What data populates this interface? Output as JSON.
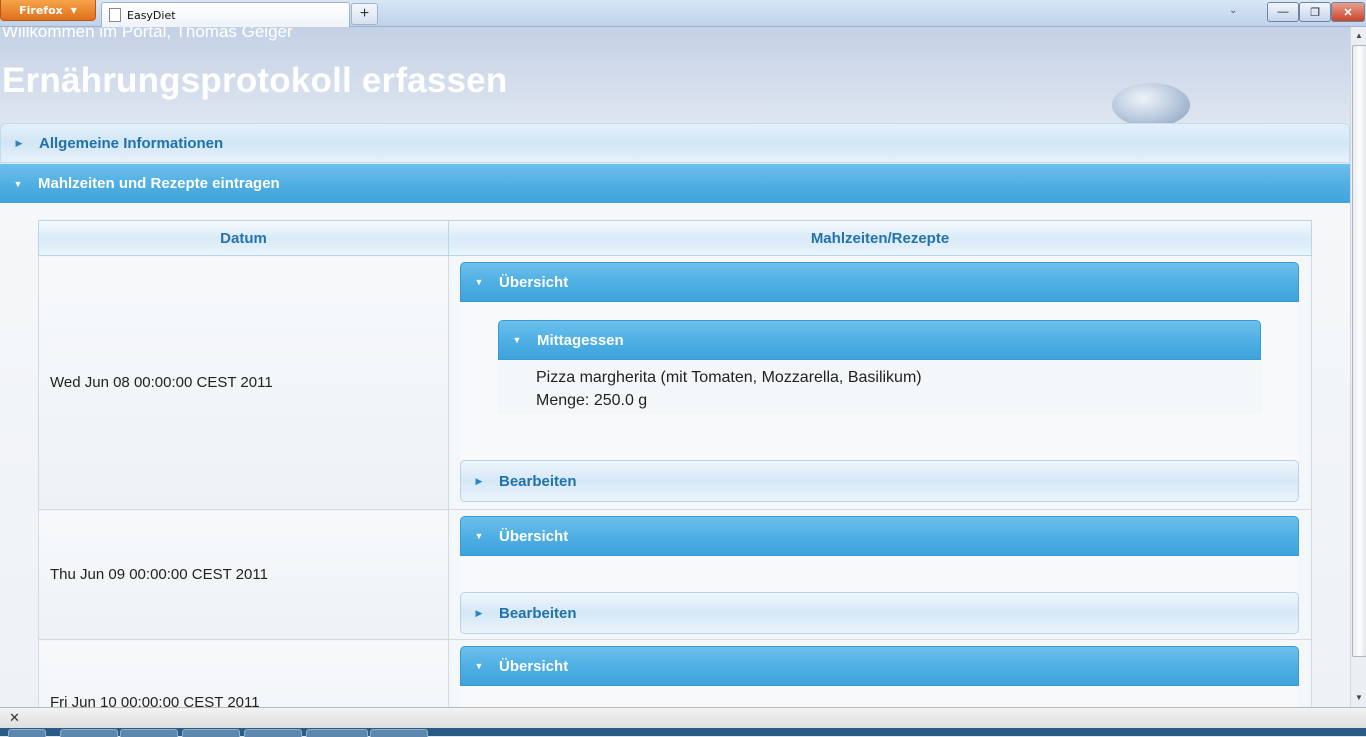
{
  "browser": {
    "menu_button": "Firefox",
    "menu_arrow": "▼",
    "tab_title": "EasyDiet",
    "new_tab": "+",
    "tab_list_icon": "chevron-down-icon",
    "controls": {
      "minimize": "—",
      "maximize": "❐",
      "close": "✕"
    }
  },
  "header": {
    "welcome": "Willkommen im Portal, Thomas Geiger",
    "title": "Ernährungsprotokoll erfassen"
  },
  "accordion": {
    "general": {
      "label": "Allgemeine Informationen",
      "expanded": false
    },
    "meals": {
      "label": "Mahlzeiten und Rezepte eintragen",
      "expanded": true
    }
  },
  "table": {
    "columns": [
      "Datum",
      "Mahlzeiten/Rezepte"
    ],
    "rows": [
      {
        "date": "Wed Jun 08 00:00:00 CEST 2011",
        "overview_label": "Übersicht",
        "meal_label": "Mittagessen",
        "food": "Pizza margherita (mit Tomaten, Mozzarella, Basilikum)",
        "amount": "Menge: 250.0 g",
        "edit_label": "Bearbeiten"
      },
      {
        "date": "Thu Jun 09 00:00:00 CEST 2011",
        "overview_label": "Übersicht",
        "edit_label": "Bearbeiten"
      },
      {
        "date": "Fri Jun 10 00:00:00 CEST 2011",
        "overview_label": "Übersicht"
      }
    ]
  },
  "statusbar": {
    "close_icon": "✕"
  },
  "colors": {
    "accent": "#4faee2",
    "label_blue": "#2172a9"
  }
}
